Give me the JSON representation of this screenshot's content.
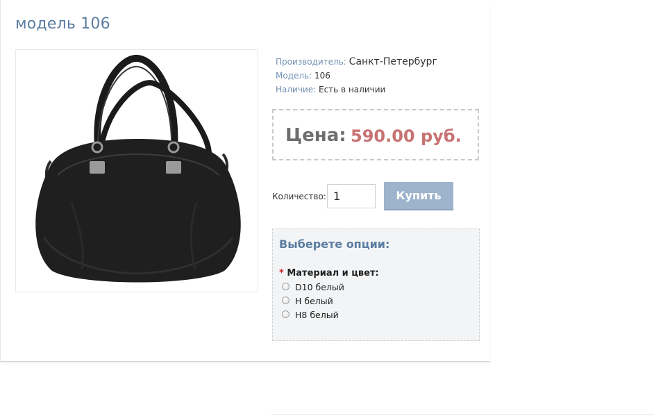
{
  "product": {
    "title": "модель 106",
    "image_alt": "black leather handbag"
  },
  "info": {
    "manufacturer_label": "Производитель:",
    "manufacturer_value": "Санкт-Петербург",
    "model_label": "Модель:",
    "model_value": "106",
    "availability_label": "Наличие:",
    "availability_value": "Есть в наличии"
  },
  "price": {
    "label": "Цена:",
    "value": "590.00 руб."
  },
  "purchase": {
    "quantity_label": "Количество:",
    "quantity_value": "1",
    "buy_label": "Купить"
  },
  "options": {
    "title": "Выберете опции:",
    "required_mark": "*",
    "group_label": "Материал и цвет:",
    "items": [
      {
        "label": "D10 белый",
        "selected": false
      },
      {
        "label": "H белый",
        "selected": false
      },
      {
        "label": "H8 белый",
        "selected": false
      }
    ]
  },
  "colors": {
    "title": "#5b7da0",
    "label": "#6f8fb1",
    "price": "#c87272",
    "button": "#9eb3cc",
    "options_bg": "#f2f4f6"
  }
}
